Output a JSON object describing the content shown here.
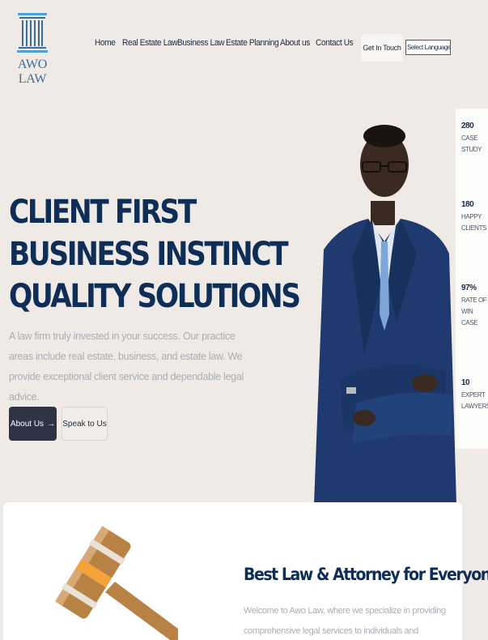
{
  "header": {
    "logo_text": "AWO LAW",
    "nav": [
      "Home",
      "Real Estate Law",
      "Business Law",
      "Estate Planning",
      "About us",
      "Contact Us"
    ],
    "cta_label": "Get In Touch",
    "language_select": "Select Language"
  },
  "hero": {
    "title_lines": [
      "CLIENT FIRST",
      "BUSINESS INSTINCT",
      "QUALITY SOLUTIONS"
    ],
    "description": "A law firm truly invested in your success. Our practice areas include real estate, business, and estate law. We provide exceptional client service and dependable legal advice.",
    "about_button": "About Us",
    "speak_button": "Speak to Us"
  },
  "stats": [
    {
      "value": "280",
      "label": "CASE STUDY"
    },
    {
      "value": "180",
      "label": "HAPPY CLIENTS"
    },
    {
      "value": "97%",
      "label": "RATE OF WIN CASE"
    },
    {
      "value": "10",
      "label": "EXPERT LAWYERS"
    }
  ],
  "intro": {
    "title": "Best Law & Attorney for Everyone",
    "text": "Welcome to Awo Law, where we specialize in providing comprehensive legal services to individuals and businesses. Our experienced attorneys"
  },
  "colors": {
    "background": "#efeae5",
    "heading": "#0f2e57",
    "logo": "#3d6d99",
    "button_dark": "#2e3446"
  }
}
